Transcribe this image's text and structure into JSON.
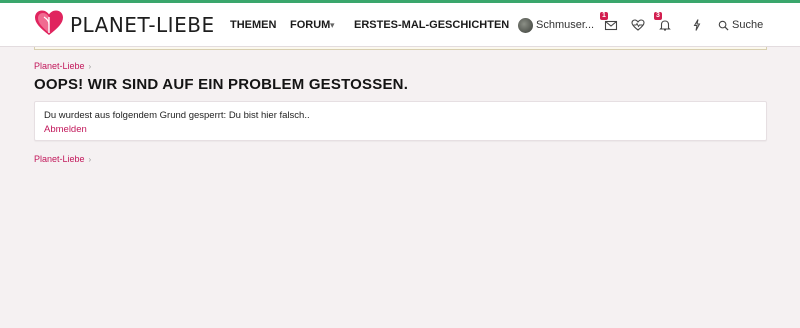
{
  "header": {
    "logo_text": "PLANET-LIEBE",
    "nav": {
      "themen": "THEMEN",
      "forum": "FORUM",
      "forum_dropdown": "▾",
      "geschichten": "ERSTES-MAL-GESCHICHTEN"
    },
    "user_name": "Schmuser...",
    "messages_badge": "1",
    "alerts_badge": "3",
    "search_label": "Suche"
  },
  "breadcrumb": {
    "top": "Planet-Liebe",
    "bottom": "Planet-Liebe",
    "separator": "›"
  },
  "main": {
    "title": "OOPS! WIR SIND AUF EIN PROBLEM GESTOSSEN.",
    "message": "Du wurdest aus folgendem Grund gesperrt: Du bist hier falsch..",
    "logout_link": "Abmelden"
  },
  "colors": {
    "accent": "#c2185b",
    "top_line": "#3aa66c",
    "background": "#f5f1f2",
    "badge": "#d21e4f"
  },
  "icons": [
    "heart-logo-icon",
    "envelope-icon",
    "heartbeat-icon",
    "bell-icon",
    "bolt-icon",
    "search-icon"
  ]
}
